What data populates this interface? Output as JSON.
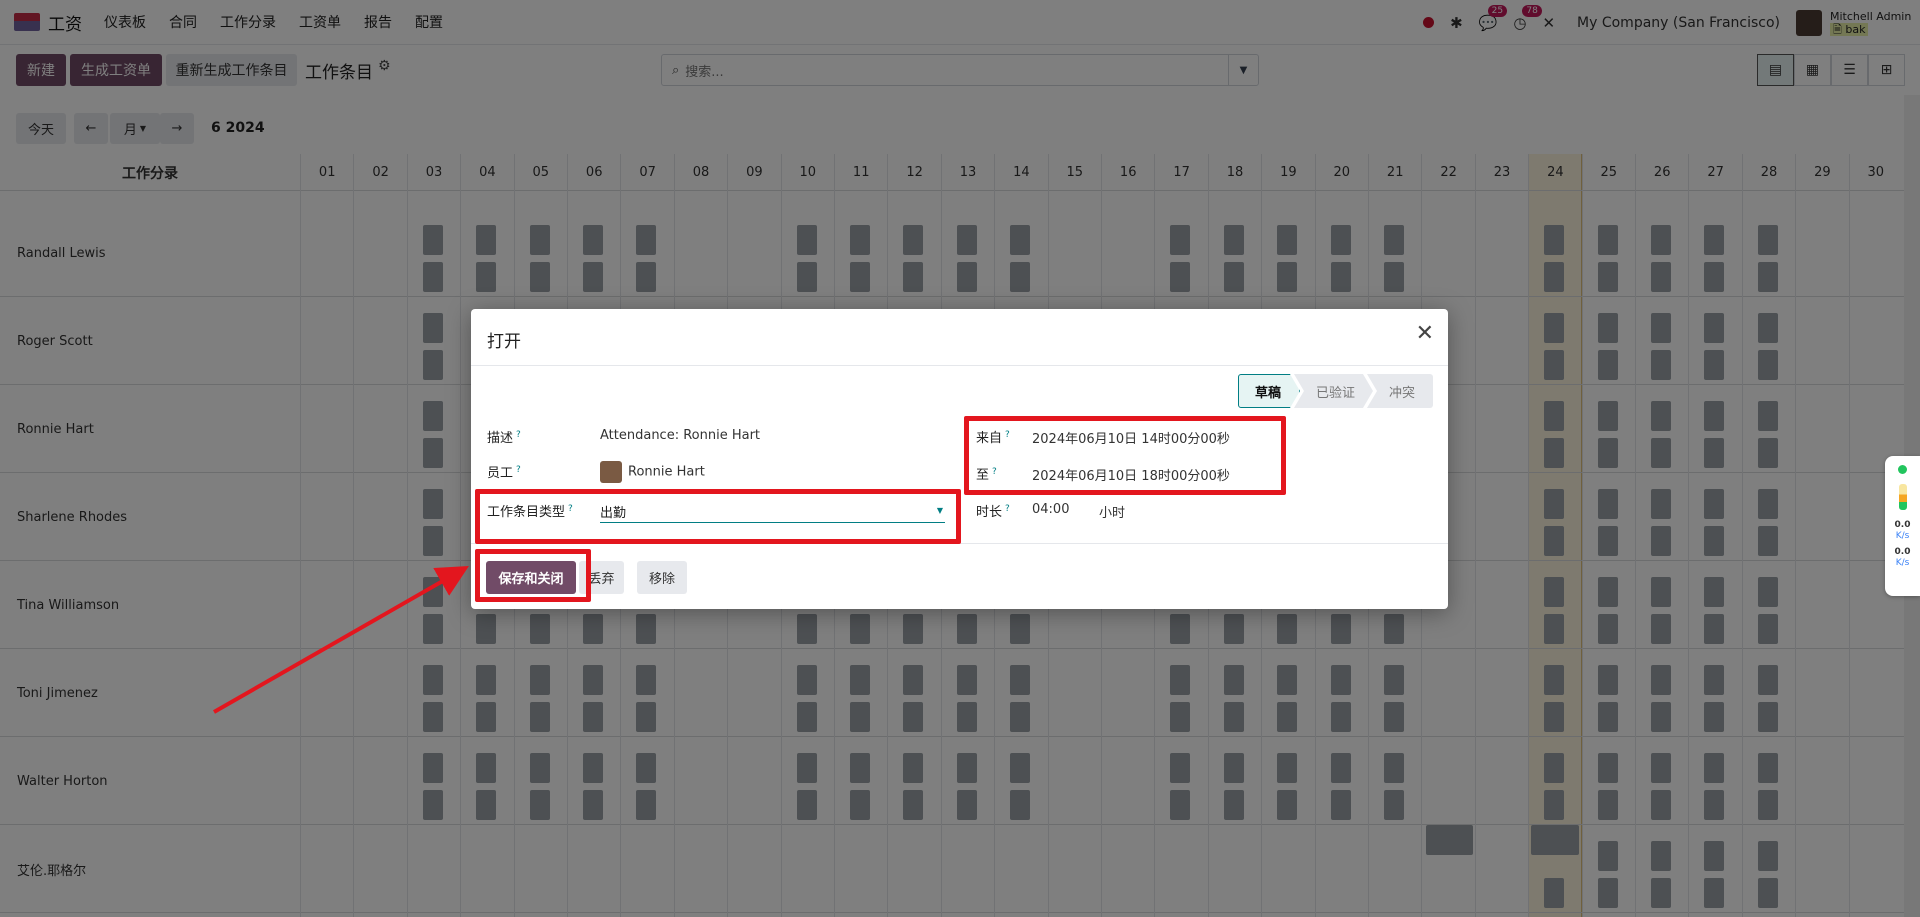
{
  "navbar": {
    "app_name": "工资",
    "menu": [
      "仪表板",
      "合同",
      "工作分录",
      "工资单",
      "报告",
      "配置"
    ],
    "messages_badge": "25",
    "activity_badge": "78",
    "company": "My Company (San Francisco)",
    "user_name": "Mitchell Admin",
    "user_db": "bak"
  },
  "control": {
    "new_label": "新建",
    "generate_payslip_label": "生成工资单",
    "regenerate_label": "重新生成工作条目",
    "title": "工作条目",
    "search_placeholder": "搜索..."
  },
  "gantt_toolbar": {
    "today_label": "今天",
    "scale_label": "月",
    "period_label": "6 2024"
  },
  "gantt": {
    "title": "工作分录",
    "days": [
      "01",
      "02",
      "03",
      "04",
      "05",
      "06",
      "07",
      "08",
      "09",
      "10",
      "11",
      "12",
      "13",
      "14",
      "15",
      "16",
      "17",
      "18",
      "19",
      "20",
      "21",
      "22",
      "23",
      "24",
      "25",
      "26",
      "27",
      "28",
      "29",
      "30"
    ],
    "today": "24",
    "rows": [
      "Randall Lewis",
      "Roger Scott",
      "Ronnie Hart",
      "Sharlene Rhodes",
      "Tina Williamson",
      "Toni Jimenez",
      "Walter Horton",
      "艾伦.耶格尔"
    ]
  },
  "network_widget": {
    "down_value": "0.0",
    "down_unit": "K/s",
    "up_value": "0.0",
    "up_unit": "K/s"
  },
  "modal": {
    "title": "打开",
    "statuses": [
      "草稿",
      "已验证",
      "冲突"
    ],
    "active_status": "草稿",
    "fields": {
      "description_label": "描述",
      "description_value": "Attendance: Ronnie Hart",
      "employee_label": "员工",
      "employee_value": "Ronnie Hart",
      "type_label": "工作条目类型",
      "type_value": "出勤",
      "from_label": "来自",
      "from_value": "2024年06月10日 14时00分00秒",
      "to_label": "至",
      "to_value": "2024年06月10日 18时00分00秒",
      "duration_label": "时长",
      "duration_value": "04:00",
      "duration_unit": "小时"
    },
    "buttons": {
      "save": "保存和关闭",
      "discard": "丢弃",
      "remove": "移除"
    }
  },
  "colors": {
    "primary": "#714b67",
    "accent": "#017e84",
    "highlight": "#e3161e"
  }
}
